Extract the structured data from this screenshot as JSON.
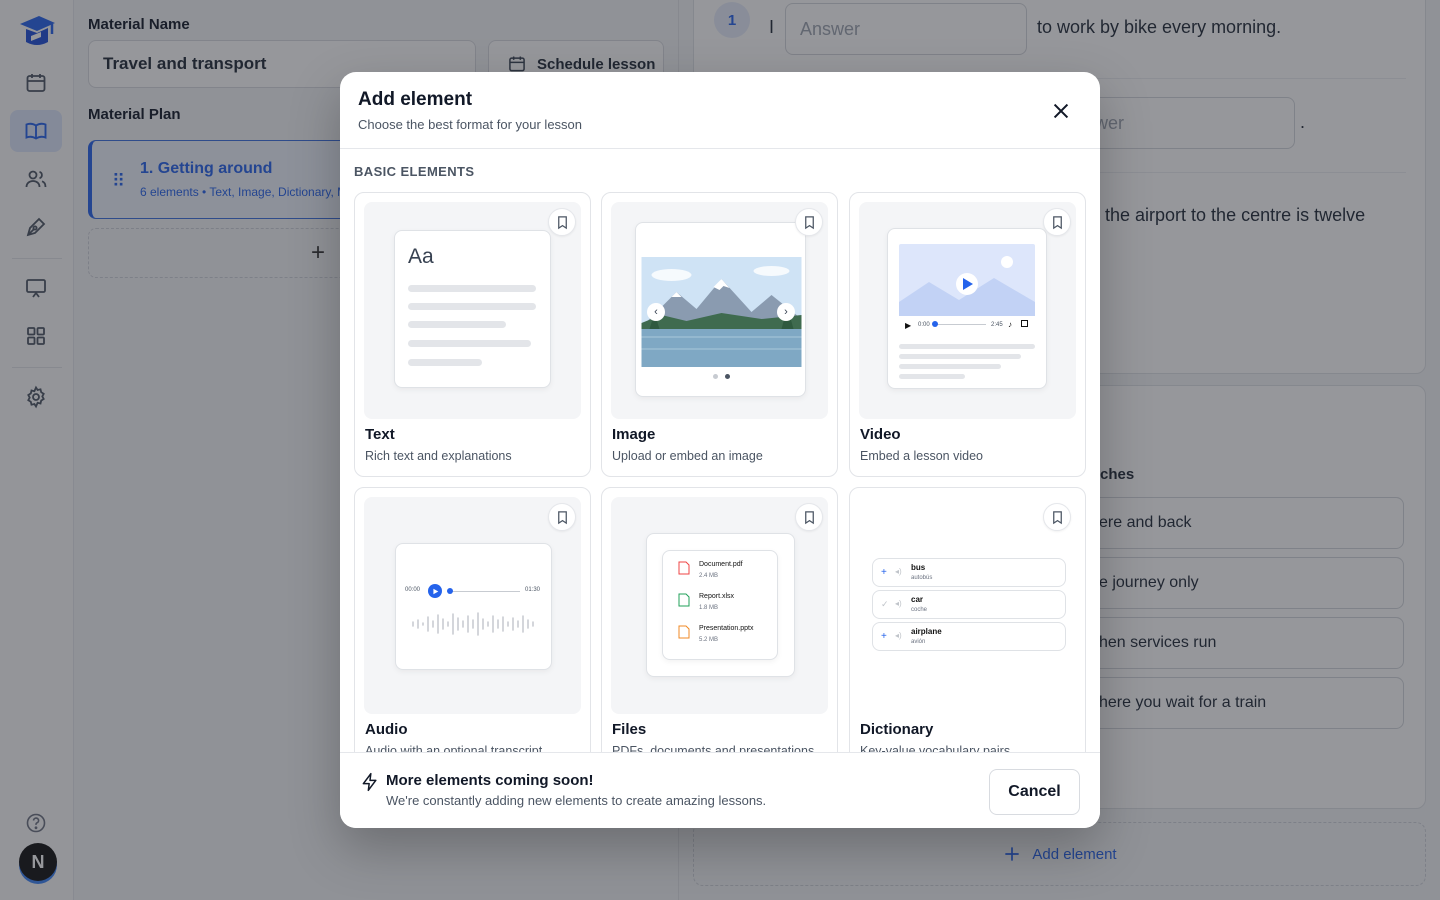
{
  "page": {
    "material_name_label": "Material Name",
    "material_name_value": "Travel and transport",
    "schedule_button": "Schedule lesson",
    "material_plan_label": "Material Plan",
    "plan_item": {
      "title": "1. Getting around",
      "meta": "6 elements • Text, Image, Dictionary, M"
    },
    "plan_add_symbol": "+",
    "exercise": {
      "number": "1",
      "line1_prefix": "I",
      "answer_placeholder": "Answer",
      "line1_suffix": "to work by bike every morning.",
      "line2_answer_partial": "wer",
      "line2_suffix": ".",
      "line3_partial": "the airport to the centre is twelve"
    },
    "matches": {
      "label_partial": "ches",
      "options": [
        "ere and back",
        "e journey only",
        "hen services run",
        "here you wait for a train"
      ]
    },
    "add_element_button": "Add element"
  },
  "sidebar": {
    "avatar_initial": "N"
  },
  "modal": {
    "title": "Add element",
    "subtitle": "Choose the best format for your lesson",
    "section_title": "BASIC ELEMENTS",
    "cards": [
      {
        "title": "Text",
        "desc": "Rich text and explanations"
      },
      {
        "title": "Image",
        "desc": "Upload or embed an image"
      },
      {
        "title": "Video",
        "desc": "Embed a lesson video"
      },
      {
        "title": "Audio",
        "desc": "Audio with an optional transcript"
      },
      {
        "title": "Files",
        "desc": "PDFs, documents and presentations"
      },
      {
        "title": "Dictionary",
        "desc": "Key-value vocabulary pairs"
      }
    ],
    "text_thumb_aa": "Aa",
    "video_thumb": {
      "start": "0:00",
      "end": "2:45"
    },
    "audio_thumb": {
      "start": "00:00",
      "end": "01:30"
    },
    "files_thumb": [
      {
        "name": "Document.pdf",
        "size": "2.4 MB",
        "color": "#ef4444"
      },
      {
        "name": "Report.xlsx",
        "size": "1.8 MB",
        "color": "#22a05a"
      },
      {
        "name": "Presentation.pptx",
        "size": "5.2 MB",
        "color": "#f08a24"
      }
    ],
    "dictionary_thumb": [
      {
        "word": "bus",
        "translation": "autobús"
      },
      {
        "word": "car",
        "translation": "coche"
      },
      {
        "word": "airplane",
        "translation": "avión"
      }
    ],
    "footer_title": "More elements coming soon!",
    "footer_sub": "We're constantly adding new elements to create amazing lessons.",
    "cancel_button": "Cancel"
  },
  "colors": {
    "accent": "#2563eb",
    "overlay": "rgba(35,38,46,0.48)"
  },
  "icons": [
    "logo-icon",
    "calendar-icon",
    "book-icon",
    "users-icon",
    "pen-icon",
    "presentation-icon",
    "grid-icon",
    "gear-icon",
    "help-icon",
    "close-icon",
    "bookmark-icon",
    "play-icon",
    "lightning-icon",
    "plus-icon",
    "drag-handle-icon"
  ]
}
